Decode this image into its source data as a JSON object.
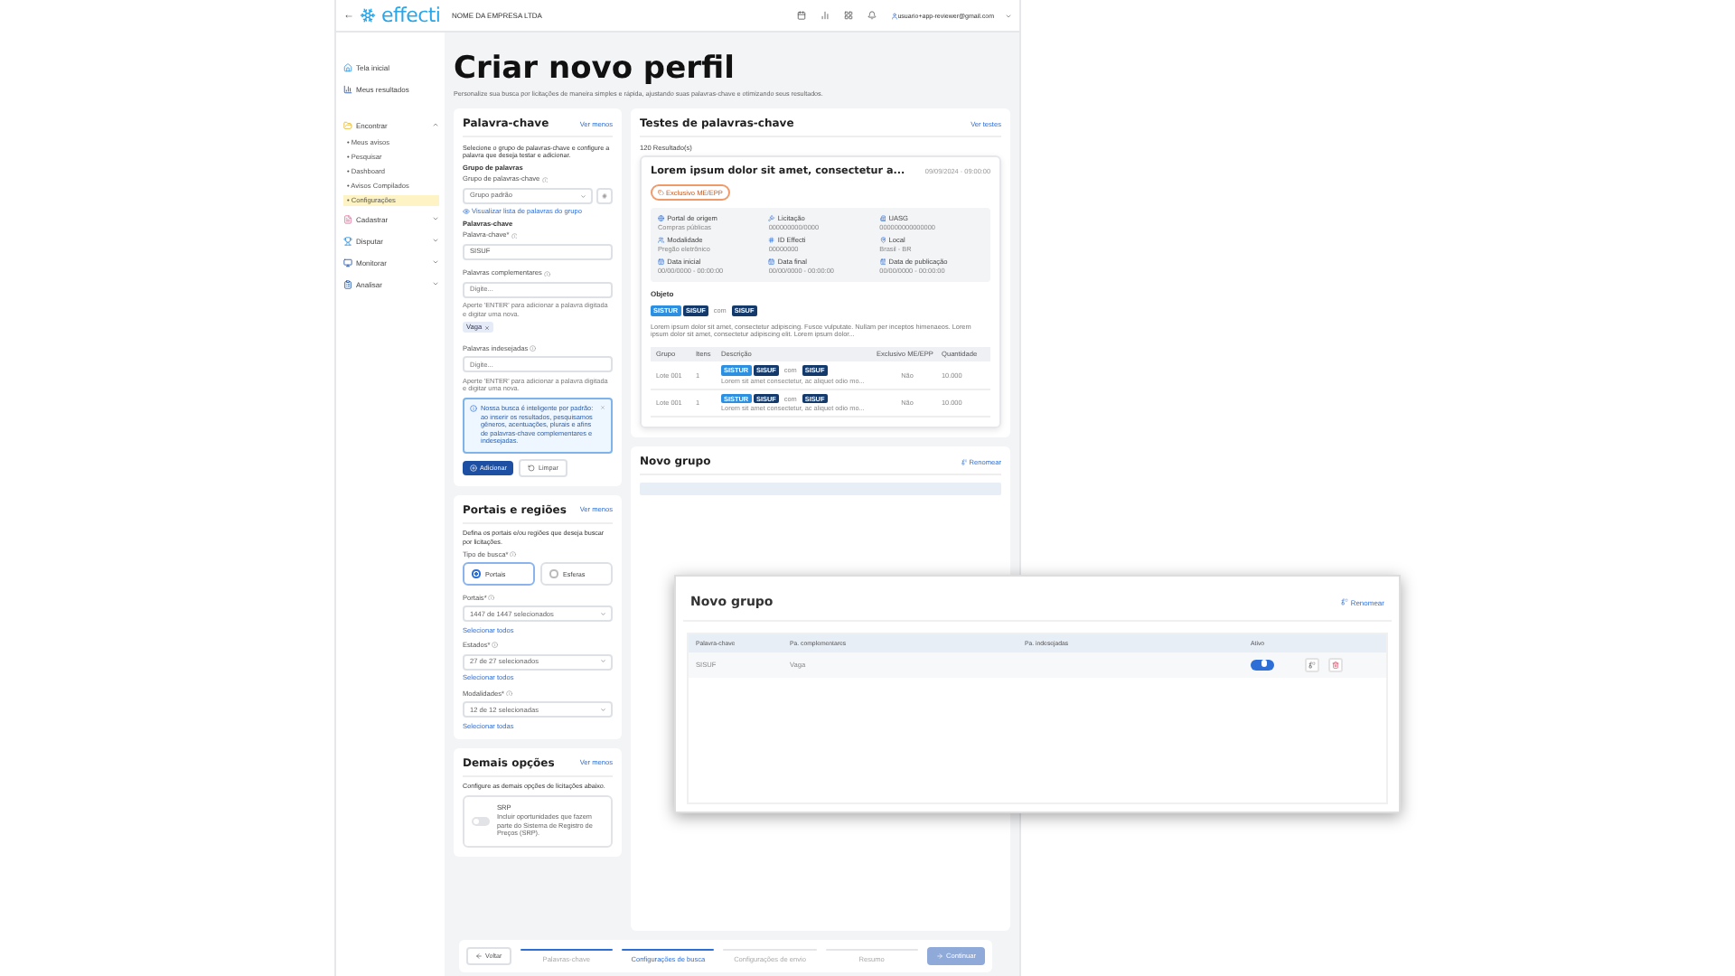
{
  "topbar": {
    "back": "←",
    "logo": "effecti",
    "company": "NOME DA EMPRESA LTDA",
    "user": "usuario+app-reviewer@gmail.com"
  },
  "sidebar": {
    "items": [
      {
        "label": "Tela inicial",
        "kind": "link"
      },
      {
        "label": "Meus resultados",
        "kind": "link"
      },
      {
        "label": "Encontrar",
        "kind": "group",
        "expanded": true,
        "children": [
          {
            "label": "• Meus avisos",
            "selected": false
          },
          {
            "label": "• Pesquisar",
            "selected": false
          },
          {
            "label": "• Dashboard",
            "selected": false
          },
          {
            "label": "• Avisos Compilados",
            "selected": false
          },
          {
            "label": "• Configurações",
            "selected": true
          }
        ]
      },
      {
        "label": "Cadastrar",
        "kind": "group",
        "expanded": false
      },
      {
        "label": "Disputar",
        "kind": "group",
        "expanded": false
      },
      {
        "label": "Monitorar",
        "kind": "group",
        "expanded": false
      },
      {
        "label": "Analisar",
        "kind": "group",
        "expanded": false
      }
    ]
  },
  "page": {
    "title": "Criar novo perfil",
    "subtitle": "Personalize sua busca por licitações de maneira simples e rápida, ajustando suas palavras-chave e otimizando seus resultados."
  },
  "keyword_card": {
    "title": "Palavra-chave",
    "toggle": "Ver menos",
    "description": "Selecione o grupo de palavras-chave e configure a palavra que deseja testar e adicionar.",
    "group_heading": "Grupo de palavras",
    "group_label": "Grupo de palavras-chave",
    "group_value": "Grupo padrão",
    "view_link": "Visualizar lista de palavras do grupo",
    "keywords_heading": "Palavras-chave",
    "keyword_label": "Palavra-chave*",
    "keyword_value": "SISUF",
    "complementary": {
      "label": "Palavras complementares",
      "placeholder": "Digite...",
      "hint": "Aperte 'ENTER' para adicionar a palavra digitada e digitar uma nova.",
      "tags": [
        "Vaga"
      ]
    },
    "unwanted": {
      "label": "Palavras indesejadas",
      "placeholder": "Digite...",
      "hint": "Aperte 'ENTER' para adicionar a palavra digitada e digitar uma nova."
    },
    "info": "Nossa busca é inteligente por padrão: ao inserir os resultados, pesquisamos gêneros, acentuações, plurais e afins de palavras-chave complementares e indesejadas.",
    "add": "Adicionar",
    "clear": "Limpar"
  },
  "portals_card": {
    "title": "Portais e regiões",
    "toggle": "Ver menos",
    "description": "Defina os portais e/ou regiões que deseja buscar por licitações.",
    "search_type_label": "Tipo de busca*",
    "options": [
      {
        "label": "Portais",
        "selected": true
      },
      {
        "label": "Esferas",
        "selected": false
      }
    ],
    "selects": [
      {
        "label": "Portais*",
        "value": "1447 de 1447 selecionados",
        "link": "Selecionar todos"
      },
      {
        "label": "Estados*",
        "value": "27 de 27 selecionados",
        "link": "Selecionar todos"
      },
      {
        "label": "Modalidades*",
        "value": "12 de 12 selecionadas",
        "link": "Selecionar todas"
      }
    ]
  },
  "other_card": {
    "title": "Demais opções",
    "toggle": "Ver menos",
    "description": "Configure as demais opções de licitações abaixo.",
    "option": {
      "title": "SRP",
      "text": "Incluir oportunidades que fazem parte do Sistema de Registro de Preços (SRP).",
      "on": false
    }
  },
  "tests_card": {
    "title": "Testes de palavras-chave",
    "toggle": "Ver testes",
    "count": "120 Resultado(s)",
    "result": {
      "title": "Lorem ipsum dolor sit amet, consectetur a...",
      "date": "09/09/2024 · 09:00:00",
      "badge": "Exclusivo ME/EPP",
      "fields": [
        {
          "label": "Portal de origem",
          "value": "Compras públicas"
        },
        {
          "label": "Licitação",
          "value": "000000000/0000"
        },
        {
          "label": "UASG",
          "value": "000000000000000"
        },
        {
          "label": "Modalidade",
          "value": "Pregão eletrônico"
        },
        {
          "label": "ID Effecti",
          "value": "00000000"
        },
        {
          "label": "Local",
          "value": "Brasil - BR"
        },
        {
          "label": "Data inicial",
          "value": "00/00/0000 - 00:00:00"
        },
        {
          "label": "Data final",
          "value": "00/00/0000 - 00:00:00"
        },
        {
          "label": "Data de publicação",
          "value": "00/00/0000 - 00:00:00"
        }
      ],
      "object_heading": "Objeto",
      "object_tags": [
        {
          "text": "SISTUR",
          "kind": "light"
        },
        {
          "text": "SISUF",
          "kind": "dark"
        },
        {
          "text": "com",
          "kind": "plain"
        },
        {
          "text": "SISUF",
          "kind": "dark"
        }
      ],
      "object_text": "Lorem ipsum dolor sit amet, consectetur adipiscing. Fusce vulputate. Nullam per inceptos himenaeos. Lorem ipsum dolor sit amet, consectetur adipiscing elit. Lorem ipsum dolor...",
      "columns": [
        "Grupo",
        "Itens",
        "Descrição",
        "Exclusivo ME/EPP",
        "Quantidade"
      ],
      "rows": [
        {
          "group": "Lote 001",
          "items": "1",
          "tags": [
            {
              "text": "SISTUR",
              "kind": "light"
            },
            {
              "text": "SISUF",
              "kind": "dark"
            },
            {
              "text": "com",
              "kind": "plain"
            },
            {
              "text": "SISUF",
              "kind": "dark"
            }
          ],
          "description": "Lorem sit amet consectetur, ac aliquet odio mo...",
          "exclusive": "Não",
          "quantity": "10.000"
        },
        {
          "group": "Lote 001",
          "items": "1",
          "tags": [
            {
              "text": "SISTUR",
              "kind": "light"
            },
            {
              "text": "SISUF",
              "kind": "dark"
            },
            {
              "text": "com",
              "kind": "plain"
            },
            {
              "text": "SISUF",
              "kind": "dark"
            }
          ],
          "description": "Lorem sit amet consectetur, ac aliquet odio mo...",
          "exclusive": "Não",
          "quantity": "10.000"
        }
      ]
    }
  },
  "group_card": {
    "title": "Novo grupo",
    "rename": "Renomear"
  },
  "zoom_panel": {
    "title": "Novo grupo",
    "rename": "Renomear",
    "columns": [
      "Palavra-chave",
      "Pa. complementares",
      "Pa. indesejadas",
      "Ativo"
    ],
    "rows": [
      {
        "keyword": "SISUF",
        "complementary": "Vaga",
        "active": true
      }
    ]
  },
  "footer": {
    "back": "Voltar",
    "steps": [
      {
        "label": "Palavras-chave",
        "completed": true,
        "selected": false
      },
      {
        "label": "Configurações de busca",
        "completed": true,
        "selected": true
      },
      {
        "label": "Configurações de envio",
        "completed": false,
        "selected": false
      },
      {
        "label": "Resumo",
        "completed": false,
        "selected": false
      }
    ],
    "continue": {
      "label": "Continuar",
      "disabled": true
    }
  }
}
